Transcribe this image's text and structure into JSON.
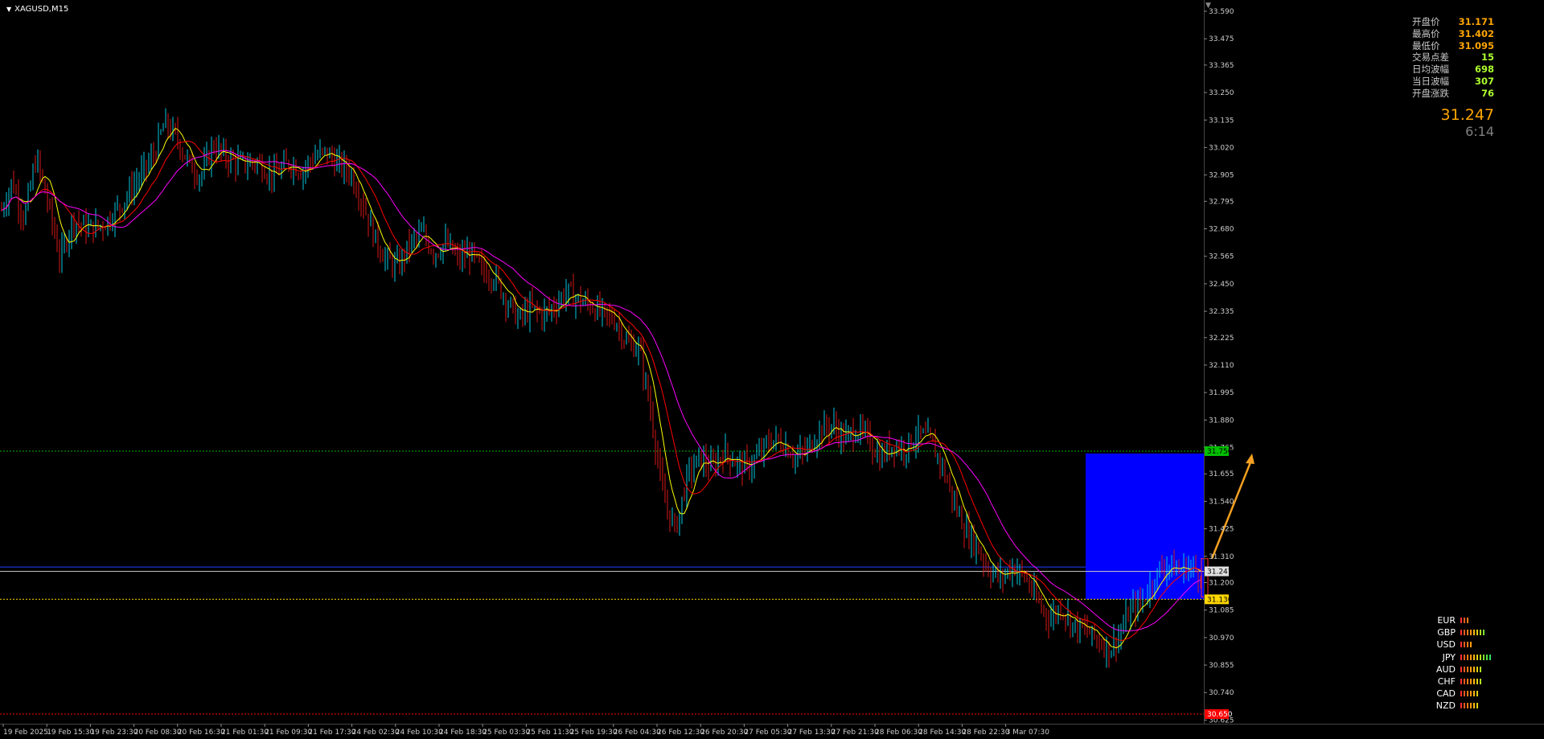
{
  "window": {
    "symbol_title": "XAGUSD,M15"
  },
  "stats": [
    {
      "label": "开盘价",
      "value": "31.171",
      "color": "#ffa500"
    },
    {
      "label": "最高价",
      "value": "31.402",
      "color": "#ffa500"
    },
    {
      "label": "最低价",
      "value": "31.095",
      "color": "#ffa500"
    },
    {
      "label": "交易点差",
      "value": "15",
      "color": "#adff2f"
    },
    {
      "label": "日均波幅",
      "value": "698",
      "color": "#adff2f"
    },
    {
      "label": "当日波幅",
      "value": "307",
      "color": "#adff2f"
    },
    {
      "label": "开盘涨跌",
      "value": "76",
      "color": "#adff2f"
    }
  ],
  "current_price": "31.247",
  "candle_timer": "6:14",
  "currency_strength": [
    {
      "name": "EUR",
      "bars": 3
    },
    {
      "name": "GBP",
      "bars": 8
    },
    {
      "name": "USD",
      "bars": 4
    },
    {
      "name": "JPY",
      "bars": 10
    },
    {
      "name": "AUD",
      "bars": 7
    },
    {
      "name": "CHF",
      "bars": 7
    },
    {
      "name": "CAD",
      "bars": 6
    },
    {
      "name": "NZD",
      "bars": 6
    }
  ],
  "colors": {
    "background": "#000000",
    "bull_candle": "#00c8e0",
    "bear_candle": "#d81818",
    "ma_fast": "#ffff00",
    "ma_mid": "#ff0000",
    "ma_slow": "#ff00ff",
    "zone_fill": "#0000ff",
    "target_line": "#00b000",
    "support_line": "#ffd700",
    "price_line": "#c0c0c0",
    "arrow": "#f4a020",
    "low_line": "#ff0000"
  },
  "chart_data": {
    "type": "candlestick",
    "symbol": "XAGUSD",
    "timeframe": "M15",
    "ylim": [
      30.65,
      33.59
    ],
    "y_ticks": [
      "33.590",
      "33.475",
      "33.365",
      "33.250",
      "33.135",
      "33.020",
      "32.905",
      "32.795",
      "32.680",
      "32.565",
      "32.450",
      "32.335",
      "32.225",
      "32.110",
      "31.995",
      "31.880",
      "31.765",
      "31.655",
      "31.540",
      "31.425",
      "31.310",
      "31.200",
      "31.085",
      "30.970",
      "30.855",
      "30.740",
      "30.625"
    ],
    "x_ticks": [
      "19 Feb 2025",
      "19 Feb 15:30",
      "19 Feb 23:30",
      "20 Feb 08:30",
      "20 Feb 16:30",
      "21 Feb 01:30",
      "21 Feb 09:30",
      "21 Feb 17:30",
      "24 Feb 02:30",
      "24 Feb 10:30",
      "24 Feb 18:30",
      "25 Feb 03:30",
      "25 Feb 11:30",
      "25 Feb 19:30",
      "26 Feb 04:30",
      "26 Feb 12:30",
      "26 Feb 20:30",
      "27 Feb 05:30",
      "27 Feb 13:30",
      "27 Feb 21:30",
      "28 Feb 06:30",
      "28 Feb 14:30",
      "28 Feb 22:30",
      "3 Mar 07:30"
    ],
    "price_path": [
      [
        0,
        32.74
      ],
      [
        15,
        32.88
      ],
      [
        30,
        32.72
      ],
      [
        45,
        32.98
      ],
      [
        60,
        32.78
      ],
      [
        75,
        32.55
      ],
      [
        90,
        32.72
      ],
      [
        110,
        32.68
      ],
      [
        130,
        32.7
      ],
      [
        150,
        32.78
      ],
      [
        170,
        32.88
      ],
      [
        190,
        32.98
      ],
      [
        205,
        33.12
      ],
      [
        220,
        33.06
      ],
      [
        235,
        32.95
      ],
      [
        250,
        32.9
      ],
      [
        265,
        33.03
      ],
      [
        280,
        32.98
      ],
      [
        300,
        32.95
      ],
      [
        320,
        32.96
      ],
      [
        340,
        32.9
      ],
      [
        360,
        32.96
      ],
      [
        375,
        32.92
      ],
      [
        390,
        32.98
      ],
      [
        405,
        33.0
      ],
      [
        420,
        32.95
      ],
      [
        435,
        32.92
      ],
      [
        450,
        32.8
      ],
      [
        465,
        32.65
      ],
      [
        480,
        32.55
      ],
      [
        495,
        32.52
      ],
      [
        510,
        32.62
      ],
      [
        525,
        32.66
      ],
      [
        540,
        32.58
      ],
      [
        555,
        32.62
      ],
      [
        570,
        32.55
      ],
      [
        585,
        32.58
      ],
      [
        600,
        32.5
      ],
      [
        615,
        32.48
      ],
      [
        630,
        32.38
      ],
      [
        645,
        32.3
      ],
      [
        660,
        32.35
      ],
      [
        675,
        32.32
      ],
      [
        690,
        32.36
      ],
      [
        705,
        32.42
      ],
      [
        720,
        32.38
      ],
      [
        735,
        32.36
      ],
      [
        750,
        32.32
      ],
      [
        765,
        32.3
      ],
      [
        780,
        32.2
      ],
      [
        795,
        32.18
      ],
      [
        810,
        31.9
      ],
      [
        825,
        31.55
      ],
      [
        840,
        31.42
      ],
      [
        855,
        31.65
      ],
      [
        870,
        31.72
      ],
      [
        885,
        31.68
      ],
      [
        900,
        31.75
      ],
      [
        915,
        31.7
      ],
      [
        930,
        31.68
      ],
      [
        945,
        31.74
      ],
      [
        960,
        31.8
      ],
      [
        975,
        31.78
      ],
      [
        990,
        31.72
      ],
      [
        1005,
        31.76
      ],
      [
        1020,
        31.84
      ],
      [
        1035,
        31.86
      ],
      [
        1050,
        31.8
      ],
      [
        1065,
        31.84
      ],
      [
        1080,
        31.8
      ],
      [
        1095,
        31.72
      ],
      [
        1110,
        31.78
      ],
      [
        1125,
        31.76
      ],
      [
        1140,
        31.82
      ],
      [
        1155,
        31.8
      ],
      [
        1170,
        31.7
      ],
      [
        1185,
        31.55
      ],
      [
        1200,
        31.42
      ],
      [
        1215,
        31.35
      ],
      [
        1230,
        31.25
      ],
      [
        1245,
        31.22
      ],
      [
        1260,
        31.27
      ],
      [
        1275,
        31.22
      ],
      [
        1290,
        31.12
      ],
      [
        1305,
        31.05
      ],
      [
        1320,
        31.1
      ],
      [
        1335,
        31.02
      ],
      [
        1350,
        31.0
      ],
      [
        1365,
        30.96
      ],
      [
        1380,
        30.92
      ],
      [
        1395,
        31.0
      ],
      [
        1405,
        31.08
      ],
      [
        1420,
        31.12
      ],
      [
        1435,
        31.22
      ],
      [
        1450,
        31.28
      ],
      [
        1465,
        31.25
      ],
      [
        1480,
        31.27
      ],
      [
        1490,
        31.24
      ],
      [
        1497,
        31.25
      ]
    ],
    "levels": {
      "target": "31.750",
      "current": "31.247",
      "support": "31.130",
      "low": "30.650"
    },
    "zone": {
      "top": 31.74,
      "bottom": 31.13
    },
    "arrow": {
      "from": [
        1505,
        31.3
      ],
      "to": [
        1555,
        31.74
      ]
    }
  }
}
